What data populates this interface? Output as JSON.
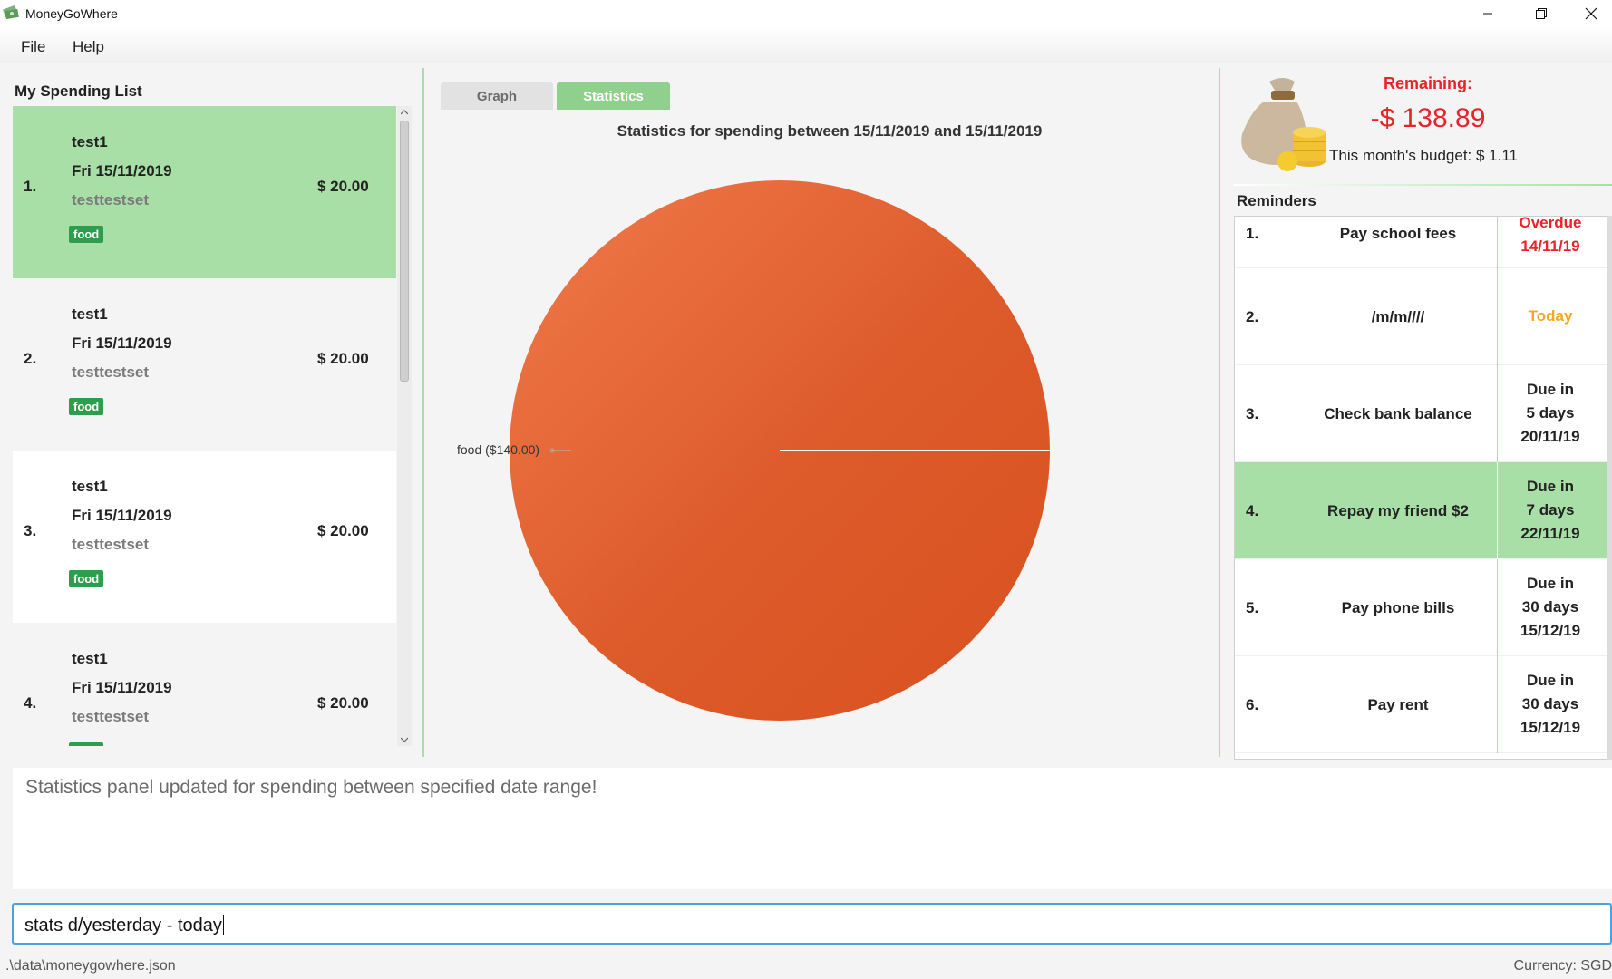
{
  "window": {
    "title": "MoneyGoWhere"
  },
  "menu": {
    "file": "File",
    "help": "Help"
  },
  "spending": {
    "title": "My Spending List",
    "items": [
      {
        "index": "1.",
        "name": "test1",
        "date": "Fri 15/11/2019",
        "remark": "testtestset",
        "tag": "food",
        "cost": "$ 20.00"
      },
      {
        "index": "2.",
        "name": "test1",
        "date": "Fri 15/11/2019",
        "remark": "testtestset",
        "tag": "food",
        "cost": "$ 20.00"
      },
      {
        "index": "3.",
        "name": "test1",
        "date": "Fri 15/11/2019",
        "remark": "testtestset",
        "tag": "food",
        "cost": "$ 20.00"
      },
      {
        "index": "4.",
        "name": "test1",
        "date": "Fri 15/11/2019",
        "remark": "testtestset",
        "tag": "food",
        "cost": "$ 20.00"
      }
    ]
  },
  "tabs": {
    "graph": "Graph",
    "statistics": "Statistics",
    "selected": "Statistics"
  },
  "stats": {
    "title": "Statistics for spending between 15/11/2019 and 15/11/2019"
  },
  "chart_data": {
    "type": "pie",
    "slices": [
      {
        "label": "food ($140.00)",
        "value": 140.0,
        "color": "#dd5a2a"
      }
    ]
  },
  "budget": {
    "remaining_label": "Remaining:",
    "remaining_value": "-$ 138.89",
    "monthly_budget": "This month's budget: $ 1.11",
    "remaining_color": "#e8232a"
  },
  "reminders": {
    "title": "Reminders",
    "items": [
      {
        "index": "1.",
        "title": "Pay school fees",
        "due": [
          "Overdue",
          "14/11/19"
        ],
        "status": "overdue"
      },
      {
        "index": "2.",
        "title": "/m/m////",
        "due": [
          "Today"
        ],
        "status": "today"
      },
      {
        "index": "3.",
        "title": "Check bank balance",
        "due": [
          "Due in",
          "5 days",
          "20/11/19"
        ],
        "status": "normal"
      },
      {
        "index": "4.",
        "title": "Repay my friend $2",
        "due": [
          "Due in",
          "7 days",
          "22/11/19"
        ],
        "status": "selected"
      },
      {
        "index": "5.",
        "title": "Pay phone bills",
        "due": [
          "Due in",
          "30 days",
          "15/12/19"
        ],
        "status": "normal"
      },
      {
        "index": "6.",
        "title": "Pay rent",
        "due": [
          "Due in",
          "30 days",
          "15/12/19"
        ],
        "status": "normal"
      }
    ]
  },
  "result": {
    "message": "Statistics panel updated for spending between specified date range!"
  },
  "command": {
    "value": "stats d/yesterday - today"
  },
  "status": {
    "file_path": ".\\data\\moneygowhere.json",
    "currency": "Currency: SGD"
  },
  "colors": {
    "accent": "#a8dfa6",
    "tag": "#2e9e4c",
    "pie": "#dd5a2a",
    "focus": "#4aa3df"
  }
}
